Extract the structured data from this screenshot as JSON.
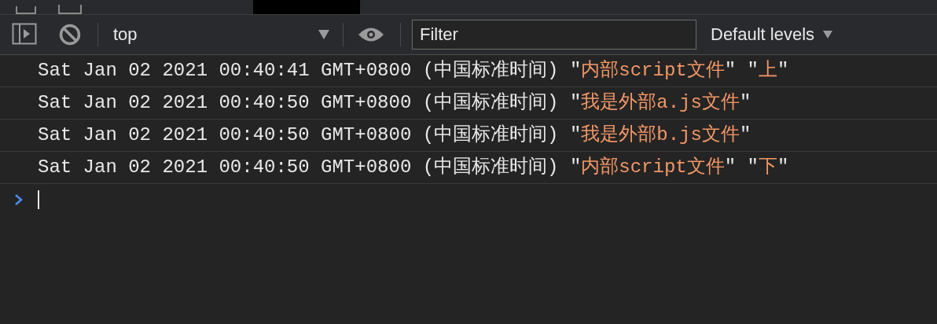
{
  "toolbar": {
    "context": "top",
    "filter": {
      "placeholder": "Filter"
    },
    "levels": "Default levels"
  },
  "messages": [
    {
      "prefix": "Sat Jan 02 2021 00:40:41 GMT+0800 (中国标准时间)",
      "args": [
        {
          "open": "\"",
          "value": "内部script文件",
          "close": "\""
        },
        {
          "open": "\"",
          "value": "上",
          "close": "\""
        }
      ]
    },
    {
      "prefix": "Sat Jan 02 2021 00:40:50 GMT+0800 (中国标准时间)",
      "args": [
        {
          "open": "\"",
          "value": "我是外部a.js文件",
          "close": "\""
        }
      ]
    },
    {
      "prefix": "Sat Jan 02 2021 00:40:50 GMT+0800 (中国标准时间)",
      "args": [
        {
          "open": "\"",
          "value": "我是外部b.js文件",
          "close": "\""
        }
      ]
    },
    {
      "prefix": "Sat Jan 02 2021 00:40:50 GMT+0800 (中国标准时间)",
      "args": [
        {
          "open": "\"",
          "value": "内部script文件",
          "close": "\""
        },
        {
          "open": "\"",
          "value": "下",
          "close": "\""
        }
      ]
    }
  ]
}
